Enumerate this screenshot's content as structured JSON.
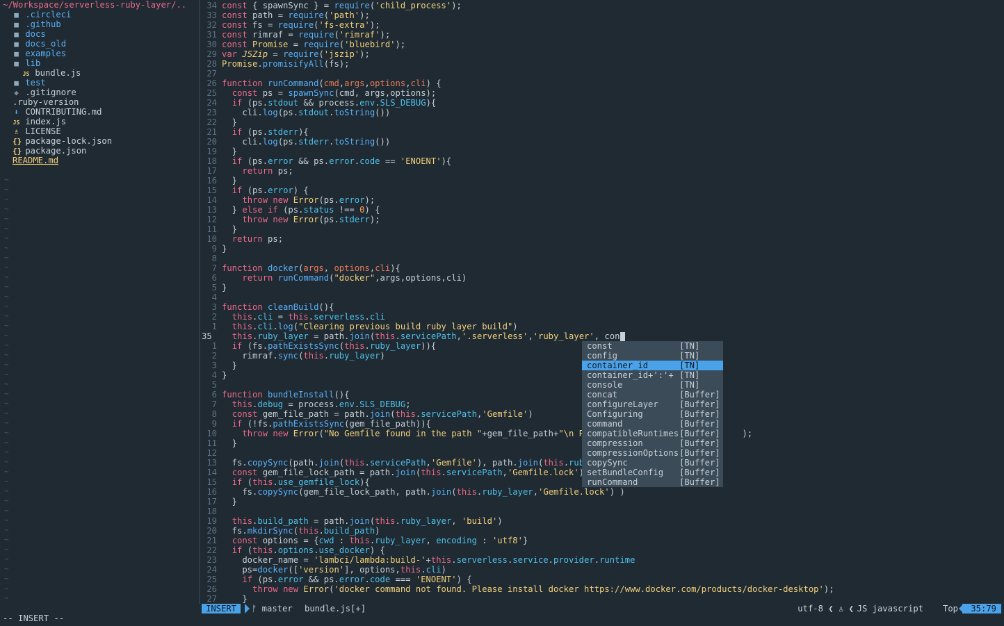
{
  "tree": {
    "root": "~/Workspace/serverless-ruby-layer/..",
    "items": [
      {
        "icon": "folder-icon",
        "glyph": "■",
        "label": ".circleci",
        "color": "#5ab0f6",
        "indent": 1
      },
      {
        "icon": "folder-icon",
        "glyph": "■",
        "label": ".github",
        "color": "#5ab0f6",
        "indent": 1
      },
      {
        "icon": "folder-icon",
        "glyph": "■",
        "label": "docs",
        "color": "#5ab0f6",
        "indent": 1
      },
      {
        "icon": "folder-icon",
        "glyph": "■",
        "label": "docs_old",
        "color": "#5ab0f6",
        "indent": 1
      },
      {
        "icon": "folder-icon",
        "glyph": "■",
        "label": "examples",
        "color": "#5ab0f6",
        "indent": 1
      },
      {
        "icon": "folder-icon",
        "glyph": "■",
        "label": "lib",
        "color": "#5ab0f6",
        "indent": 1
      },
      {
        "icon": "js-icon",
        "glyph": "JS",
        "label": "bundle.js",
        "color": "#c8d0d6",
        "indent": 2
      },
      {
        "icon": "folder-icon",
        "glyph": "■",
        "label": "test",
        "color": "#5ab0f6",
        "indent": 1
      },
      {
        "icon": "git-icon",
        "glyph": "◆",
        "label": ".gitignore",
        "color": "#c8d0d6",
        "indent": 1
      },
      {
        "icon": "",
        "glyph": "",
        "label": ".ruby-version",
        "color": "#c8d0d6",
        "indent": 1
      },
      {
        "icon": "markdown-icon",
        "glyph": "⬇",
        "label": "CONTRIBUTING.md",
        "color": "#c8d0d6",
        "indent": 1
      },
      {
        "icon": "js-icon",
        "glyph": "JS",
        "label": "index.js",
        "color": "#c8d0d6",
        "indent": 1
      },
      {
        "icon": "license-icon",
        "glyph": "♗",
        "label": "LICENSE",
        "color": "#c8d0d6",
        "indent": 1
      },
      {
        "icon": "json-icon",
        "glyph": "{}",
        "label": "package-lock.json",
        "color": "#c8d0d6",
        "indent": 1
      },
      {
        "icon": "json-icon",
        "glyph": "{}",
        "label": "package.json",
        "color": "#c8d0d6",
        "indent": 1
      },
      {
        "icon": "",
        "glyph": "",
        "label": "README.md",
        "color": "#f3d07a",
        "indent": 1
      }
    ]
  },
  "editor": {
    "lines": [
      {
        "n": "34",
        "h": "<span class=\"kw\">const</span> { spawnSync } = <span class=\"fn\">require</span>(<span class=\"str\">'child_process'</span>);"
      },
      {
        "n": "33",
        "h": "<span class=\"kw\">const</span> path = <span class=\"fn\">require</span>(<span class=\"str\">'path'</span>);"
      },
      {
        "n": "32",
        "h": "<span class=\"kw\">const</span> fs = <span class=\"fn\">require</span>(<span class=\"str\">'fs-extra'</span>);"
      },
      {
        "n": "31",
        "h": "<span class=\"kw\">const</span> rimraf = <span class=\"fn\">require</span>(<span class=\"str\">'rimraf'</span>);"
      },
      {
        "n": "30",
        "h": "<span class=\"kw\">const</span> <span class=\"cls\">Promise</span> = <span class=\"fn\">require</span>(<span class=\"str\">'bluebird'</span>);"
      },
      {
        "n": "29",
        "h": "<span class=\"kw\">var</span> <span class=\"cls\"><i>JSZip</i></span> = <span class=\"fn\">require</span>(<span class=\"str\">'jszip'</span>);"
      },
      {
        "n": "28",
        "h": "<span class=\"cls\">Promise</span>.<span class=\"fn\">promisifyAll</span>(fs);"
      },
      {
        "n": "27",
        "h": ""
      },
      {
        "n": "26",
        "h": "<span class=\"kw\">function</span> <span class=\"fn\">runCommand</span>(<span class=\"pm\">cmd</span>,<span class=\"pm\">args</span>,<span class=\"pm\">options</span>,<span class=\"pm\">cli</span>) {"
      },
      {
        "n": "25",
        "h": "  <span class=\"kw\">const</span> ps = <span class=\"fn\">spawnSync</span>(cmd, args,options);"
      },
      {
        "n": "24",
        "h": "  <span class=\"kw\">if</span> (ps.<span class=\"prop\">stdout</span> &amp;&amp; process.<span class=\"prop\">env</span>.<span class=\"prop\">SLS_DEBUG</span>){"
      },
      {
        "n": "23",
        "h": "    cli.<span class=\"fn\">log</span>(ps.<span class=\"prop\">stdout</span>.<span class=\"fn\">toString</span>())"
      },
      {
        "n": "22",
        "h": "  }"
      },
      {
        "n": "21",
        "h": "  <span class=\"kw\">if</span> (ps.<span class=\"prop\">stderr</span>){"
      },
      {
        "n": "20",
        "h": "    cli.<span class=\"fn\">log</span>(ps.<span class=\"prop\">stderr</span>.<span class=\"fn\">toString</span>())"
      },
      {
        "n": "19",
        "h": "  }"
      },
      {
        "n": "18",
        "h": "  <span class=\"kw\">if</span> (ps.<span class=\"prop\">error</span> &amp;&amp; ps.<span class=\"prop\">error</span>.<span class=\"prop\">code</span> == <span class=\"str\">'ENOENT'</span>){"
      },
      {
        "n": "17",
        "h": "    <span class=\"kw\">return</span> ps;"
      },
      {
        "n": "16",
        "h": "  }"
      },
      {
        "n": "15",
        "h": "  <span class=\"kw\">if</span> (ps.<span class=\"prop\">error</span>) {"
      },
      {
        "n": "14",
        "h": "    <span class=\"kw\">throw</span> <span class=\"kw\">new</span> <span class=\"cls\">Error</span>(ps.<span class=\"prop\">error</span>);"
      },
      {
        "n": "13",
        "h": "  } <span class=\"kw\">else</span> <span class=\"kw\">if</span> (ps.<span class=\"prop\">status</span> !== <span class=\"num\">0</span>) {"
      },
      {
        "n": "12",
        "h": "    <span class=\"kw\">throw</span> <span class=\"kw\">new</span> <span class=\"cls\">Error</span>(ps.<span class=\"prop\">stderr</span>);"
      },
      {
        "n": "11",
        "h": "  }"
      },
      {
        "n": "10",
        "h": "  <span class=\"kw\">return</span> ps;"
      },
      {
        "n": "9",
        "h": "}"
      },
      {
        "n": "8",
        "h": ""
      },
      {
        "n": "7",
        "h": "<span class=\"kw\">function</span> <span class=\"fn\">docker</span>(<span class=\"pm\">args</span>, <span class=\"pm\">options</span>,<span class=\"pm\">cli</span>){"
      },
      {
        "n": "6",
        "h": "    <span class=\"kw\">return</span> <span class=\"fn\">runCommand</span>(<span class=\"str\">\"docker\"</span>,args,options,cli)"
      },
      {
        "n": "5",
        "h": "}"
      },
      {
        "n": "4",
        "h": ""
      },
      {
        "n": "3",
        "h": "<span class=\"kw\">function</span> <span class=\"fn\">cleanBuild</span>(){"
      },
      {
        "n": "2",
        "h": "  <span class=\"th\">this</span>.<span class=\"prop\">cli</span> = <span class=\"th\">this</span>.<span class=\"prop\">serverless</span>.<span class=\"prop\">cli</span>"
      },
      {
        "n": "1",
        "h": "  <span class=\"th\">this</span>.<span class=\"prop\">cli</span>.<span class=\"fn\">log</span>(<span class=\"str\">\"Clearing previous build ruby layer build\"</span>)"
      },
      {
        "n": "35",
        "cur": true,
        "h": "  <span class=\"th\">this</span>.<span class=\"prop\">ruby_layer</span> = path.<span class=\"fn\">join</span>(<span class=\"th\">this</span>.<span class=\"prop\">servicePath</span>,<span class=\"str\">'.serverless'</span>,<span class=\"str\">'ruby_layer'</span>, con<span class=\"cursor\"></span>"
      },
      {
        "n": "1",
        "h": "  <span class=\"kw\">if</span> (fs.<span class=\"fn\">pathExistsSync</span>(<span class=\"th\">this</span>.<span class=\"prop\">ruby_layer</span>)){"
      },
      {
        "n": "2",
        "h": "    rimraf.<span class=\"fn\">sync</span>(<span class=\"th\">this</span>.<span class=\"prop\">ruby_layer</span>)"
      },
      {
        "n": "3",
        "h": "  }"
      },
      {
        "n": "4",
        "h": "}"
      },
      {
        "n": "5",
        "h": ""
      },
      {
        "n": "6",
        "h": "<span class=\"kw\">function</span> <span class=\"fn\">bundleInstall</span>(){"
      },
      {
        "n": "7",
        "h": "  <span class=\"th\">this</span>.<span class=\"prop\">debug</span> = process.<span class=\"prop\">env</span>.<span class=\"prop\">SLS_DEBUG</span>;"
      },
      {
        "n": "8",
        "h": "  <span class=\"kw\">const</span> gem_file_path = path.<span class=\"fn\">join</span>(<span class=\"th\">this</span>.<span class=\"prop\">servicePath</span>,<span class=\"str\">'Gemfile'</span>)"
      },
      {
        "n": "9",
        "h": "  <span class=\"kw\">if</span> (!fs.<span class=\"fn\">pathExistsSync</span>(gem_file_path)){"
      },
      {
        "n": "10",
        "h": "    <span class=\"kw\">throw</span> <span class=\"kw\">new</span> <span class=\"cls\">Error</span>(<span class=\"str\">\"No Gemfile found in the path \"</span>+gem_file_path+<span class=\"str\">\"\\n Plea</span>                            );"
      },
      {
        "n": "11",
        "h": "  }"
      },
      {
        "n": "12",
        "h": ""
      },
      {
        "n": "13",
        "h": "  fs.<span class=\"fn\">copySync</span>(path.<span class=\"fn\">join</span>(<span class=\"th\">this</span>.<span class=\"prop\">servicePath</span>,<span class=\"str\">'Gemfile'</span>), path.<span class=\"fn\">join</span>(<span class=\"th\">this</span>.<span class=\"prop\">ruby_l</span>"
      },
      {
        "n": "14",
        "h": "  <span class=\"kw\">const</span> gem_file_lock_path = path.<span class=\"fn\">join</span>(<span class=\"th\">this</span>.<span class=\"prop\">servicePath</span>,<span class=\"str\">'Gemfile.lock'</span>)"
      },
      {
        "n": "15",
        "h": "  <span class=\"kw\">if</span> (<span class=\"th\">this</span>.<span class=\"prop\">use_gemfile_lock</span>){"
      },
      {
        "n": "16",
        "h": "    fs.<span class=\"fn\">copySync</span>(gem_file_lock_path, path.<span class=\"fn\">join</span>(<span class=\"th\">this</span>.<span class=\"prop\">ruby_layer</span>,<span class=\"str\">'Gemfile.lock'</span>) )"
      },
      {
        "n": "17",
        "h": "  }"
      },
      {
        "n": "18",
        "h": ""
      },
      {
        "n": "19",
        "h": "  <span class=\"th\">this</span>.<span class=\"prop\">build_path</span> = path.<span class=\"fn\">join</span>(<span class=\"th\">this</span>.<span class=\"prop\">ruby_layer</span>, <span class=\"str\">'build'</span>)"
      },
      {
        "n": "20",
        "h": "  fs.<span class=\"fn\">mkdirSync</span>(<span class=\"th\">this</span>.<span class=\"prop\">build_path</span>)"
      },
      {
        "n": "21",
        "h": "  <span class=\"kw\">const</span> options = {<span class=\"prop\">cwd</span> : <span class=\"th\">this</span>.<span class=\"prop\">ruby_layer</span>, <span class=\"prop\">encoding</span> : <span class=\"str\">'utf8'</span>}"
      },
      {
        "n": "22",
        "h": "  <span class=\"kw\">if</span> (<span class=\"th\">this</span>.<span class=\"prop\">options</span>.<span class=\"prop\">use_docker</span>) {"
      },
      {
        "n": "23",
        "h": "    docker_name = <span class=\"str\">'lambci/lambda:build-'</span>+<span class=\"th\">this</span>.<span class=\"prop\">serverless</span>.<span class=\"prop\">service</span>.<span class=\"prop\">provider</span>.<span class=\"prop\">runtime</span>"
      },
      {
        "n": "24",
        "h": "    ps=<span class=\"fn\">docker</span>([<span class=\"str\">'version'</span>], options,<span class=\"th\">this</span>.<span class=\"prop\">cli</span>)"
      },
      {
        "n": "25",
        "h": "    <span class=\"kw\">if</span> (ps.<span class=\"prop\">error</span> &amp;&amp; ps.<span class=\"prop\">error</span>.<span class=\"prop\">code</span> === <span class=\"str\">'ENOENT'</span>) {"
      },
      {
        "n": "26",
        "h": "      <span class=\"kw\">throw</span> <span class=\"kw\">new</span> <span class=\"cls\">Error</span>(<span class=\"str\">'docker command not found. Please install docker https://www.docker.com/products/docker-desktop'</span>);"
      },
      {
        "n": "27",
        "h": "    }"
      }
    ]
  },
  "completion": {
    "items": [
      {
        "word": "const",
        "src": "[TN]"
      },
      {
        "word": "config",
        "src": "[TN]"
      },
      {
        "word": "container_id",
        "src": "[TN]",
        "selected": true
      },
      {
        "word": "container_id+':'+",
        "src": "[TN]"
      },
      {
        "word": "console",
        "src": "[TN]"
      },
      {
        "word": "concat",
        "src": "[Buffer]"
      },
      {
        "word": "configureLayer",
        "src": "[Buffer]"
      },
      {
        "word": "Configuring",
        "src": "[Buffer]"
      },
      {
        "word": "command",
        "src": "[Buffer]"
      },
      {
        "word": "compatibleRuntimes",
        "src": "[Buffer]"
      },
      {
        "word": "compression",
        "src": "[Buffer]"
      },
      {
        "word": "compressionOptions",
        "src": "[Buffer]"
      },
      {
        "word": "copySync",
        "src": "[Buffer]"
      },
      {
        "word": "setBundleConfig",
        "src": "[Buffer]"
      },
      {
        "word": "runCommand",
        "src": "[Buffer]"
      }
    ]
  },
  "status": {
    "mode": "INSERT",
    "branch_icon": "git-branch-icon",
    "branch": "ᚠ master",
    "file": "bundle.js[+]",
    "encoding": "utf-8 ❮ ♙ ❮",
    "filetype": "JS javascript",
    "position": "Top",
    "linecol": "35:79"
  },
  "cmdline": "-- INSERT --",
  "colors": {
    "accent": "#4aa3ea",
    "background": "#1f2a33",
    "popup": "#3b4b58"
  }
}
